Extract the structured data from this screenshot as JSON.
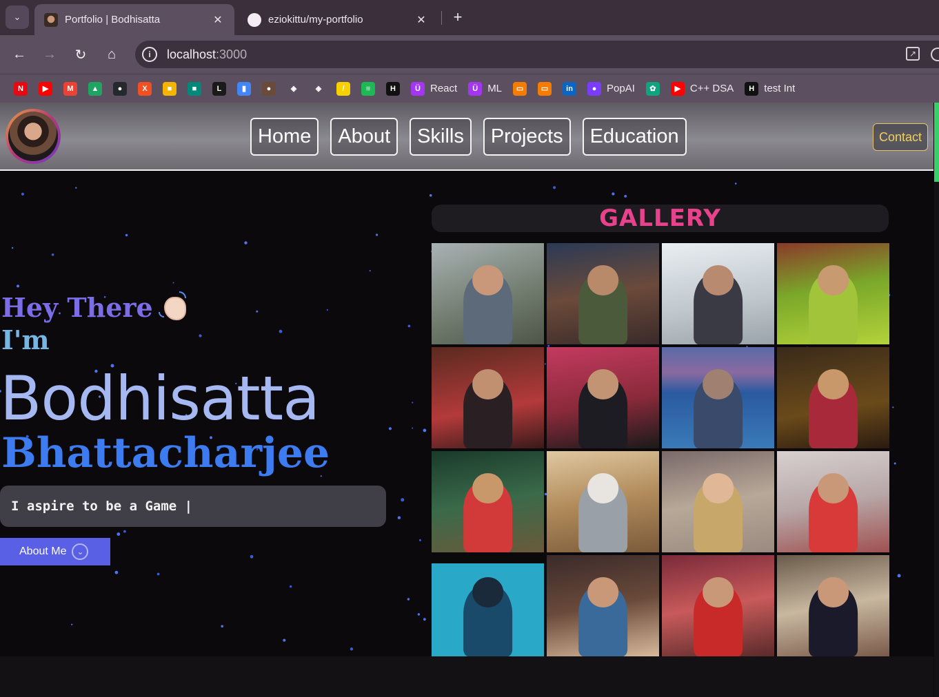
{
  "browser": {
    "tabs": [
      {
        "title": "Portfolio | Bodhisatta",
        "active": true,
        "favicon": "avatar-favicon"
      },
      {
        "title": "eziokittu/my-portfolio",
        "active": false,
        "favicon": "github-icon"
      }
    ],
    "new_tab_label": "+",
    "address": {
      "host": "localhost",
      "port": ":3000"
    },
    "bookmarks": [
      {
        "icon": "netflix-icon",
        "label": "",
        "color": "#e50914",
        "glyph": "N"
      },
      {
        "icon": "youtube-icon",
        "label": "",
        "color": "#ff0000",
        "glyph": "▶"
      },
      {
        "icon": "gmail-icon",
        "label": "",
        "color": "#ea4335",
        "glyph": "M"
      },
      {
        "icon": "google-drive-icon",
        "label": "",
        "color": "#1fa463",
        "glyph": "▲"
      },
      {
        "icon": "github-icon",
        "label": "",
        "color": "#24292e",
        "glyph": "●"
      },
      {
        "icon": "x-icon",
        "label": "",
        "color": "#f25022",
        "glyph": "X"
      },
      {
        "icon": "classroom-icon",
        "label": "",
        "color": "#f4b400",
        "glyph": "■"
      },
      {
        "icon": "meet-icon",
        "label": "",
        "color": "#00897b",
        "glyph": "■"
      },
      {
        "icon": "leetcode-icon",
        "label": "",
        "color": "#1a1a1a",
        "glyph": "L"
      },
      {
        "icon": "analytics-icon",
        "label": "",
        "color": "#4285f4",
        "glyph": "▮"
      },
      {
        "icon": "avatar-icon",
        "label": "",
        "color": "#6b4a3a",
        "glyph": "●"
      },
      {
        "icon": "unity-icon",
        "label": "",
        "color": "#5c4f5f",
        "glyph": "◈"
      },
      {
        "icon": "unity-icon",
        "label": "",
        "color": "#5c4f5f",
        "glyph": "◈"
      },
      {
        "icon": "vector-icon",
        "label": "",
        "color": "#f7d000",
        "glyph": "/"
      },
      {
        "icon": "spotify-icon",
        "label": "",
        "color": "#1db954",
        "glyph": "≡"
      },
      {
        "icon": "hackerrank-icon",
        "label": "",
        "color": "#111111",
        "glyph": "H"
      },
      {
        "icon": "udemy-icon",
        "label": "React",
        "color": "#a435f0",
        "glyph": "Ü"
      },
      {
        "icon": "udemy-icon",
        "label": "ML",
        "color": "#a435f0",
        "glyph": "Ü"
      },
      {
        "icon": "slides-icon",
        "label": "",
        "color": "#f57c00",
        "glyph": "▭"
      },
      {
        "icon": "slides-icon",
        "label": "",
        "color": "#f57c00",
        "glyph": "▭"
      },
      {
        "icon": "linkedin-icon",
        "label": "",
        "color": "#0a66c2",
        "glyph": "in"
      },
      {
        "icon": "popai-icon",
        "label": "PopAI",
        "color": "#7a3cff",
        "glyph": "●"
      },
      {
        "icon": "chatgpt-icon",
        "label": "",
        "color": "#10a37f",
        "glyph": "✿"
      },
      {
        "icon": "youtube-icon",
        "label": "C++  DSA",
        "color": "#ff0000",
        "glyph": "▶"
      },
      {
        "icon": "hackerrank-icon",
        "label": "test Int",
        "color": "#111111",
        "glyph": "H"
      }
    ]
  },
  "navbar": {
    "links": [
      "Home",
      "About",
      "Skills",
      "Projects",
      "Education"
    ],
    "contact_label": "Contact"
  },
  "hero": {
    "greeting": "Hey There",
    "im": "I'm",
    "first_name": "Bodhisatta",
    "last_name": "Bhattacharjee",
    "typing_text": "I aspire to be a Game |",
    "about_button": "About Me"
  },
  "gallery": {
    "title": "GALLERY",
    "photos": [
      {
        "bg": "linear-gradient(160deg,#a9b2b4,#6f7a6c 60%,#4d5548)",
        "body": "#5d6a7a",
        "head": "#c9987a"
      },
      {
        "bg": "linear-gradient(170deg,#2a3a55,#6b4a3a 50%,#3a2a2a)",
        "body": "#4a5a3a",
        "head": "#b88a6a"
      },
      {
        "bg": "linear-gradient(170deg,#e9eef2,#bfc7cc 60%,#9aa3aa)",
        "body": "#3a3a44",
        "head": "#b88a70"
      },
      {
        "bg": "linear-gradient(170deg,#8a3a2a,#7aa82a 45%,#b4d23a)",
        "body": "#a2c43a",
        "head": "#c89a70"
      },
      {
        "bg": "linear-gradient(170deg,#5a2a20,#b43a3a 60%,#3a1a1a)",
        "body": "#2a2024",
        "head": "#c09070"
      },
      {
        "bg": "linear-gradient(170deg,#c43a60,#8a2a3a 55%,#1a1a1a)",
        "body": "#1c1c22",
        "head": "#c39474"
      },
      {
        "bg": "linear-gradient(180deg,#5a6aa8,#8a6aa0 25%,#2a5aa0 45%,#3a7ab8)",
        "body": "#3a4a6a",
        "head": "#a08070"
      },
      {
        "bg": "linear-gradient(170deg,#3a2a1a,#6a4a1a 60%,#2a1a10)",
        "body": "#a82a3a",
        "head": "#c8986a"
      },
      {
        "bg": "linear-gradient(170deg,#1a3a2a,#3a6a4a 50%,#6a5a3a)",
        "body": "#d23a3a",
        "head": "#c8986a"
      },
      {
        "bg": "linear-gradient(170deg,#e0c8a0,#b08a5a 50%,#7a5a3a)",
        "body": "#9aa0a8",
        "head": "#e8e4e0"
      },
      {
        "bg": "linear-gradient(170deg,#7a6a6a,#b8a898 50%,#9a8a80)",
        "body": "#c8a86a",
        "head": "#e0b898"
      },
      {
        "bg": "linear-gradient(170deg,#d8d0d0,#b8a8a8 50%,#a05050)",
        "body": "#d83a3a",
        "head": "#c89878"
      },
      {
        "bg": "linear-gradient(180deg,#0a0a0a 0 8%,#2aa8c8 8% 100%)",
        "body": "#1a4a6a",
        "head": "#1a2a3a"
      },
      {
        "bg": "linear-gradient(170deg,#3a2a2a,#6a4a3a 50%,#d8b89a)",
        "body": "#3a6a9a",
        "head": "#c89878"
      },
      {
        "bg": "linear-gradient(170deg,#7a2a3a,#c85a5a 50%,#5a2a2a)",
        "body": "#c82a2a",
        "head": "#c89878"
      },
      {
        "bg": "linear-gradient(170deg,#6a5a4a,#c8b8a0 50%,#7a5a4a)",
        "body": "#1a1a2a",
        "head": "#c89878"
      }
    ]
  }
}
